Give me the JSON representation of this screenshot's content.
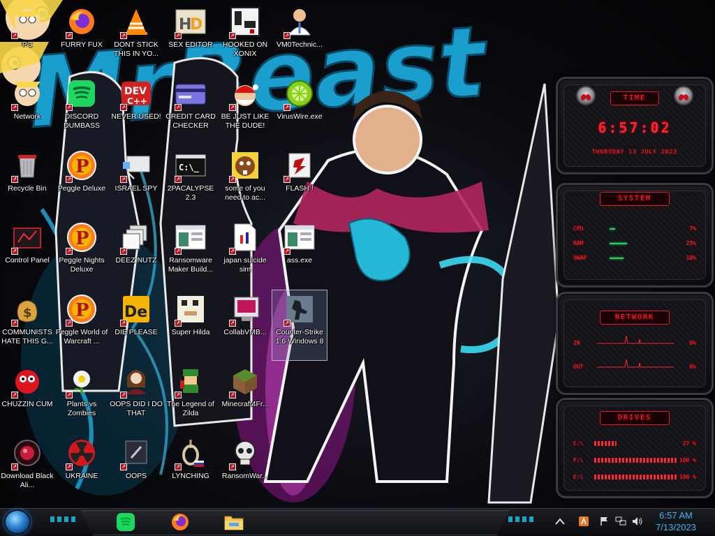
{
  "desktop": {
    "icons": [
      {
        "id": "c1-0",
        "label": "PC",
        "art": "star"
      },
      {
        "id": "c2-0",
        "label": "FURRY FUX",
        "art": "firefox"
      },
      {
        "id": "c3-0",
        "label": "DONT STICK THIS IN YO...",
        "art": "vlc"
      },
      {
        "id": "c4-0",
        "label": "SEX EDITOR",
        "art": "hxd"
      },
      {
        "id": "c5-0",
        "label": "HOOKED ON XONIX",
        "art": "xonix"
      },
      {
        "id": "c6-0",
        "label": "VM0Technic...",
        "art": "doctor"
      },
      {
        "id": "c1-1",
        "label": "Network",
        "art": "star2"
      },
      {
        "id": "c2-1",
        "label": "DISCORD DUMBASS",
        "art": "spotify"
      },
      {
        "id": "c3-1",
        "label": "NEVER USED!",
        "art": "dev"
      },
      {
        "id": "c4-1",
        "label": "CREDIT CARD CHECKER",
        "art": "card"
      },
      {
        "id": "c5-1",
        "label": "BE JUST LIKE THE DUDE!",
        "art": "santa"
      },
      {
        "id": "c6-1",
        "label": "VirusWire.exe",
        "art": "lime"
      },
      {
        "id": "c1-2",
        "label": "Recycle Bin",
        "art": "bin"
      },
      {
        "id": "c2-2",
        "label": "Peggle Deluxe",
        "art": "peggle"
      },
      {
        "id": "c3-2",
        "label": "ISRAEL SPY",
        "art": "spy"
      },
      {
        "id": "c4-2",
        "label": "2PACALYPSE 2.3",
        "art": "cmd"
      },
      {
        "id": "c5-2",
        "label": "some of you need to ac...",
        "art": "beaver"
      },
      {
        "id": "c6-2",
        "label": "FLASH !",
        "art": "flash"
      },
      {
        "id": "c1-3",
        "label": "Control Panel",
        "art": "cpanel"
      },
      {
        "id": "c2-3",
        "label": "Peggle Nights Deluxe",
        "art": "peggle"
      },
      {
        "id": "c3-3",
        "label": "DEEZ NUTZ",
        "art": "stack"
      },
      {
        "id": "c4-3",
        "label": "Ransomware Maker Build...",
        "art": "window"
      },
      {
        "id": "c5-3",
        "label": "japan suicide sim",
        "art": "doc"
      },
      {
        "id": "c6-3",
        "label": "ass.exe",
        "art": "window"
      },
      {
        "id": "c1-4",
        "label": "COMMUNISTS HATE THIS G...",
        "art": "money"
      },
      {
        "id": "c2-4",
        "label": "Peggle World of Warcraft ...",
        "art": "peggle"
      },
      {
        "id": "c3-4",
        "label": "DIE PLEASE",
        "art": "de"
      },
      {
        "id": "c4-4",
        "label": "Super Hilda",
        "art": "hilda"
      },
      {
        "id": "c5-4",
        "label": "CollabVMB...",
        "art": "collab"
      },
      {
        "id": "c6-4",
        "label": "Counter-Strike 1.6 Windows 8",
        "art": "cs"
      },
      {
        "id": "c1-5",
        "label": "CHUZZIN CUM",
        "art": "chuzzle"
      },
      {
        "id": "c2-5",
        "label": "Plants vs Zombies",
        "art": "pvz"
      },
      {
        "id": "c3-5",
        "label": "OOPS DID I DO THAT",
        "art": "portrait"
      },
      {
        "id": "c4-5",
        "label": "The Legend of Zilda",
        "art": "zelda"
      },
      {
        "id": "c5-5",
        "label": "Minecraft4Fr...",
        "art": "minecraft"
      },
      {
        "id": "c1-6",
        "label": "Download Black Ali...",
        "art": "orb"
      },
      {
        "id": "c2-6",
        "label": "UKRAINE",
        "art": "radiation"
      },
      {
        "id": "c3-6",
        "label": "OOPS",
        "art": "oops"
      },
      {
        "id": "c4-6",
        "label": "LYNCHING",
        "art": "noose"
      },
      {
        "id": "c5-6",
        "label": "RansomWar...",
        "art": "skull"
      }
    ]
  },
  "wallpaper": {
    "title_text": "Beast"
  },
  "widgets": {
    "time": {
      "title": "TIME",
      "clock": "6:57:02",
      "date": "THURSDAY 13 JULY 2023"
    },
    "system": {
      "title": "SYSTEM",
      "rows": [
        {
          "label": "CPU",
          "value": "7%",
          "level": 0.07
        },
        {
          "label": "RAM",
          "value": "23%",
          "level": 0.23
        },
        {
          "label": "SWAP",
          "value": "18%",
          "level": 0.18
        }
      ]
    },
    "network": {
      "title": "NETWORK",
      "rows": [
        {
          "label": "IN",
          "value": "0%"
        },
        {
          "label": "OUT",
          "value": "0%"
        }
      ]
    },
    "drives": {
      "title": "DRIVES",
      "rows": [
        {
          "label": "C:\\",
          "value": "27 %",
          "level": 0.27
        },
        {
          "label": "F:\\",
          "value": "100 %",
          "level": 1.0
        },
        {
          "label": "E:\\",
          "value": "100 %",
          "level": 1.0
        }
      ]
    }
  },
  "taskbar": {
    "apps": [
      {
        "name": "spotify",
        "icon": "spotify-icon"
      },
      {
        "name": "firefox",
        "icon": "firefox-icon"
      },
      {
        "name": "file-explorer",
        "icon": "folder-icon"
      }
    ],
    "clock_time": "6:57 AM",
    "clock_date": "7/13/2023"
  },
  "colors": {
    "accent_red": "#ff2530",
    "accent_cyan": "#19b4d6",
    "clock_blue": "#3fb5f0"
  }
}
